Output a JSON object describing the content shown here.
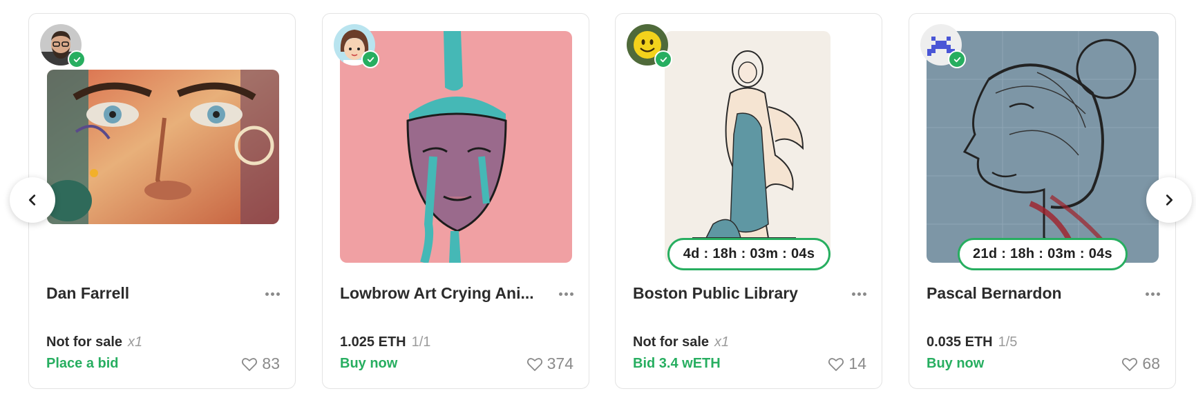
{
  "cards": [
    {
      "title": "Dan Farrell",
      "price": "Not for sale",
      "edition": "x1",
      "cta": "Place a bid",
      "likes": "83",
      "timer": ""
    },
    {
      "title": "Lowbrow Art Crying Ani...",
      "price": "1.025 ETH",
      "edition": "1/1",
      "cta": "Buy now",
      "likes": "374",
      "timer": ""
    },
    {
      "title": "Boston Public Library",
      "price": "Not for sale",
      "edition": "x1",
      "cta": "Bid 3.4 wETH",
      "likes": "14",
      "timer": "4d : 18h : 03m : 04s"
    },
    {
      "title": "Pascal Bernardon",
      "price": "0.035 ETH",
      "edition": "1/5",
      "cta": "Buy now",
      "likes": "68",
      "timer": "21d : 18h : 03m : 04s"
    }
  ],
  "colors": {
    "accent": "#27ae60",
    "muted": "#9a9a9a",
    "border": "#e3e3e3"
  },
  "icons": {
    "prev": "chevron-left-icon",
    "next": "chevron-right-icon",
    "verified": "check-icon",
    "likes": "heart-icon",
    "more": "more-horizontal-icon"
  }
}
